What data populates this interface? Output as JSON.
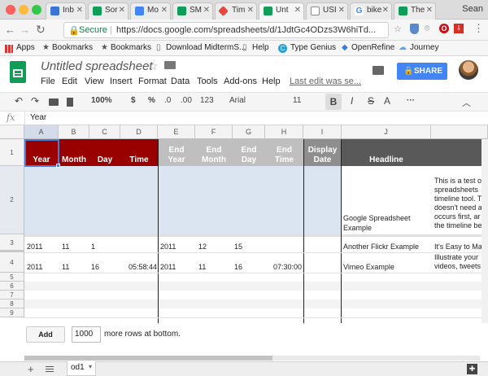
{
  "browser": {
    "tabs": [
      {
        "label": "Inb",
        "color": "#3b73d9"
      },
      {
        "label": "Sor",
        "color": "#0f9d58"
      },
      {
        "label": "Mo",
        "color": "#4285f4"
      },
      {
        "label": "SM",
        "color": "#0f9d58"
      },
      {
        "label": "Tim",
        "color": "#e8453c"
      },
      {
        "label": "Unt",
        "color": "#0f9d58"
      },
      {
        "label": "USI",
        "color": "#8a8a8a"
      },
      {
        "label": "bike",
        "color": "#4285f4"
      },
      {
        "label": "The",
        "color": "#0f9d58"
      }
    ],
    "profile_name": "Sean",
    "secure_label": "Secure",
    "url": "https://docs.google.com/spreadsheets/d/1JdtGc4ODzs3W6hiTd..."
  },
  "bookmarks": [
    "Apps",
    "Bookmarks",
    "Bookmarks",
    "Download MidtermS...",
    "Help",
    "Type Genius",
    "OpenRefine",
    "Journey"
  ],
  "doc": {
    "title": "Untitled spreadsheet",
    "menu": [
      "File",
      "Edit",
      "View",
      "Insert",
      "Format",
      "Data",
      "Tools",
      "Add-ons",
      "Help"
    ],
    "last_edit": "Last edit was se...",
    "share_label": "SHARE"
  },
  "toolbar": {
    "zoom": "100%",
    "currency": "$",
    "percent": "%",
    "dec_less": ".0",
    "dec_more": ".00",
    "more_formats": "123",
    "font": "Arial",
    "size": "11",
    "bold": "B",
    "italic": "I",
    "strike": "S",
    "text_color": "A",
    "more": "···"
  },
  "formula": {
    "fx": "fx",
    "value": "Year"
  },
  "columns": [
    "A",
    "B",
    "C",
    "D",
    "E",
    "F",
    "G",
    "H",
    "I",
    "J"
  ],
  "rows": [
    "1",
    "2",
    "3",
    "4",
    "5",
    "6",
    "7",
    "8",
    "9"
  ],
  "headers": {
    "year": "Year",
    "month": "Month",
    "day": "Day",
    "time": "Time",
    "end_year_1": "End",
    "end_year_2": "Year",
    "end_month_1": "End",
    "end_month_2": "Month",
    "end_day_1": "End",
    "end_day_2": "Day",
    "end_time_1": "End",
    "end_time_2": "Time",
    "display_date_1": "Display",
    "display_date_2": "Date",
    "headline": "Headline"
  },
  "row2": {
    "headline_1": "Google Spreadsheet",
    "headline_2": "Example",
    "text_1": "This is a test o",
    "text_2": "spreadsheets",
    "text_3": "timeline tool. T",
    "text_4": "doesn't need a",
    "text_5": "occurs first, ar",
    "text_6": "the timeline be"
  },
  "row3": {
    "year": "2011",
    "month": "11",
    "day": "1",
    "end_year": "2011",
    "end_month": "12",
    "end_day": "15",
    "headline": "Another Flickr Example",
    "text": "It's Easy to Ma"
  },
  "row4": {
    "year": "2011",
    "month": "11",
    "day": "16",
    "time": "05:58:44",
    "end_year": "2011",
    "end_month": "11",
    "end_day": "16",
    "end_time": "07:30:00",
    "headline": "Vimeo Example",
    "text_1": "Illustrate your",
    "text_2": "videos, tweets"
  },
  "footer": {
    "add_label": "Add",
    "rows_value": "1000",
    "rows_suffix": "more rows at bottom."
  },
  "sheet": {
    "plus": "+",
    "tab_label": "od1"
  },
  "colors": {
    "header_red": "#990000",
    "header_gray": "#bfbfbf",
    "header_dark": "#595959",
    "selection_blue": "#dbe5f1",
    "sheets_green": "#0f9d58",
    "share_blue": "#4285f4"
  }
}
